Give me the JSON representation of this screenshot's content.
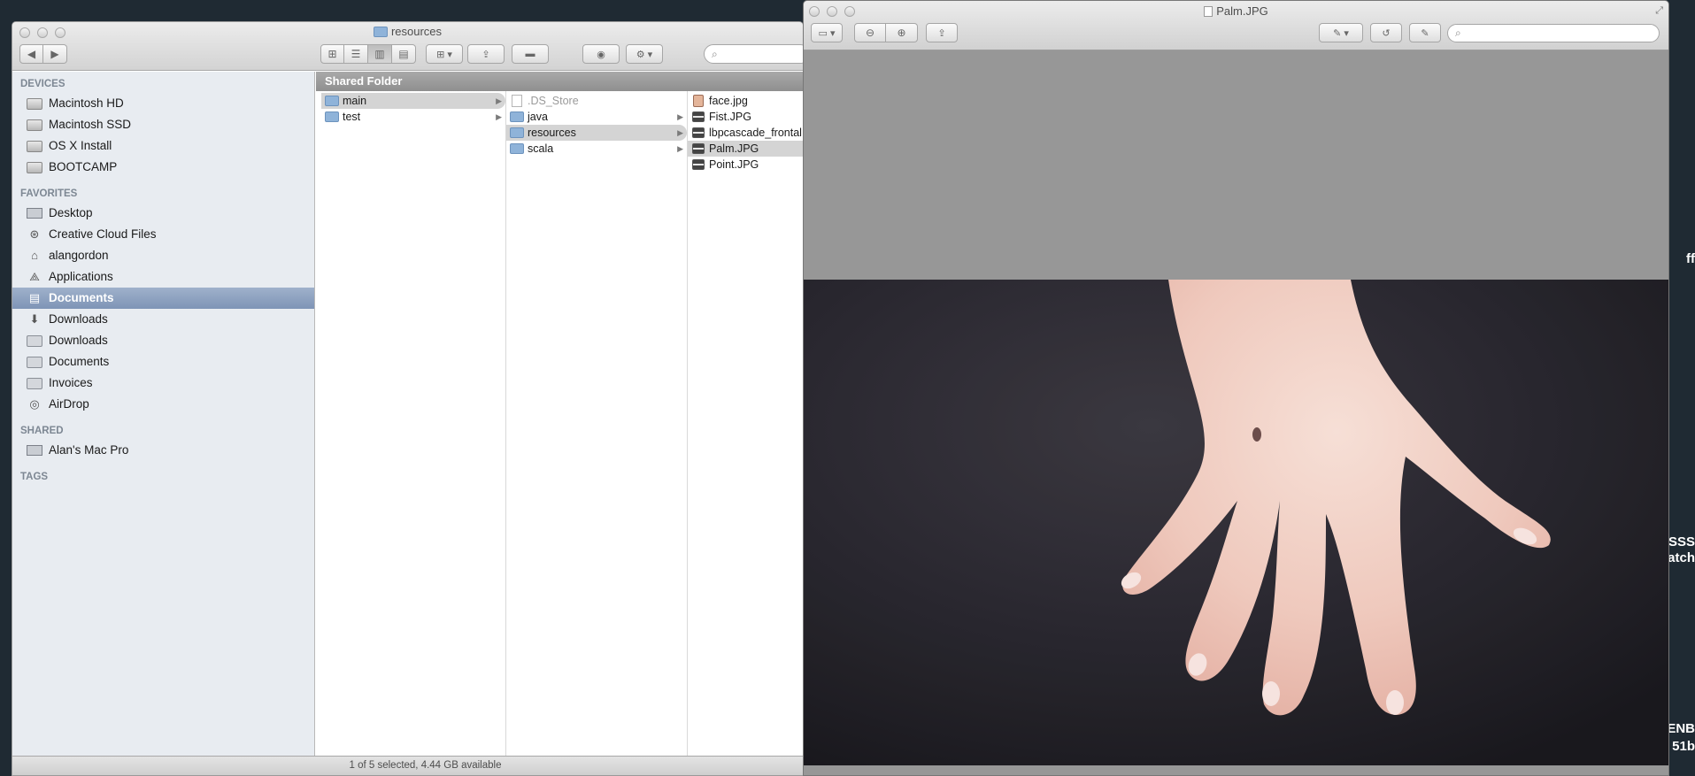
{
  "finder": {
    "title": "resources",
    "sidebar": {
      "devices_header": "DEVICES",
      "devices": [
        "Macintosh HD",
        "Macintosh SSD",
        "OS X Install",
        "BOOTCAMP"
      ],
      "favorites_header": "FAVORITES",
      "favorites": [
        {
          "label": "Desktop",
          "icon": "desktop-icon"
        },
        {
          "label": "Creative Cloud Files",
          "icon": "creative-cloud-icon"
        },
        {
          "label": "alangordon",
          "icon": "home-icon"
        },
        {
          "label": "Applications",
          "icon": "applications-icon"
        },
        {
          "label": "Documents",
          "icon": "documents-icon",
          "selected": true
        },
        {
          "label": "Downloads",
          "icon": "downloads-icon"
        },
        {
          "label": "Downloads",
          "icon": "folder-icon"
        },
        {
          "label": "Documents",
          "icon": "folder-icon"
        },
        {
          "label": "Invoices",
          "icon": "folder-icon"
        },
        {
          "label": "AirDrop",
          "icon": "airdrop-icon"
        }
      ],
      "shared_header": "SHARED",
      "shared": [
        "Alan's Mac Pro"
      ],
      "tags_header": "TAGS"
    },
    "path_header": "Shared Folder",
    "columns": [
      {
        "items": [
          {
            "label": "main",
            "selected": true,
            "arrow": true
          },
          {
            "label": "test",
            "arrow": true
          }
        ]
      },
      {
        "items": [
          {
            "label": ".DS_Store",
            "dim": true,
            "kind": "doc"
          },
          {
            "label": "java",
            "arrow": true
          },
          {
            "label": "resources",
            "selected": true,
            "arrow": true
          },
          {
            "label": "scala",
            "arrow": true
          }
        ]
      },
      {
        "items": [
          {
            "label": "face.jpg",
            "kind": "face"
          },
          {
            "label": "Fist.JPG",
            "kind": "img"
          },
          {
            "label": "lbpcascade_frontal",
            "kind": "img"
          },
          {
            "label": "Palm.JPG",
            "kind": "img",
            "selected": true
          },
          {
            "label": "Point.JPG",
            "kind": "img"
          }
        ]
      }
    ],
    "status": "1 of 5 selected, 4.44 GB available"
  },
  "preview": {
    "title": "Palm.JPG",
    "search_placeholder": ""
  },
  "desktop_labels": [
    "ff",
    "SSS",
    "atch",
    "ENB",
    "51b"
  ]
}
